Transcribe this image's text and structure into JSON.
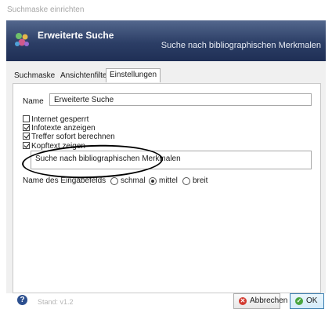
{
  "window": {
    "title": "Suchmaske einrichten"
  },
  "header": {
    "title": "Erweiterte Suche",
    "subtitle": "Suche nach bibliographischen Merkmalen"
  },
  "tabs": [
    {
      "label": "Suchmaske"
    },
    {
      "label": "Ansichtenfilter"
    },
    {
      "label": "Einstellungen",
      "active": true
    }
  ],
  "form": {
    "name_label": "Name",
    "name_value": "Erweiterte Suche",
    "checkboxes": [
      {
        "label": "Internet gesperrt",
        "checked": false
      },
      {
        "label": "Infotexte anzeigen",
        "checked": true
      },
      {
        "label": "Treffer sofort berechnen",
        "checked": true
      },
      {
        "label": "Kopftext zeigen",
        "checked": true
      }
    ],
    "header_text_value": "Suche nach bibliographischen Merkmalen",
    "field_name_label": "Name des Eingabefelds",
    "radios": [
      {
        "label": "schmal",
        "checked": false
      },
      {
        "label": "mittel",
        "checked": true
      },
      {
        "label": "breit",
        "checked": false
      }
    ]
  },
  "footer": {
    "help_glyph": "?",
    "version": "Stand: v1.2",
    "cancel_label": "Abbrechen",
    "ok_label": "OK",
    "cancel_icon_glyph": "✕",
    "ok_icon_glyph": "✓"
  }
}
